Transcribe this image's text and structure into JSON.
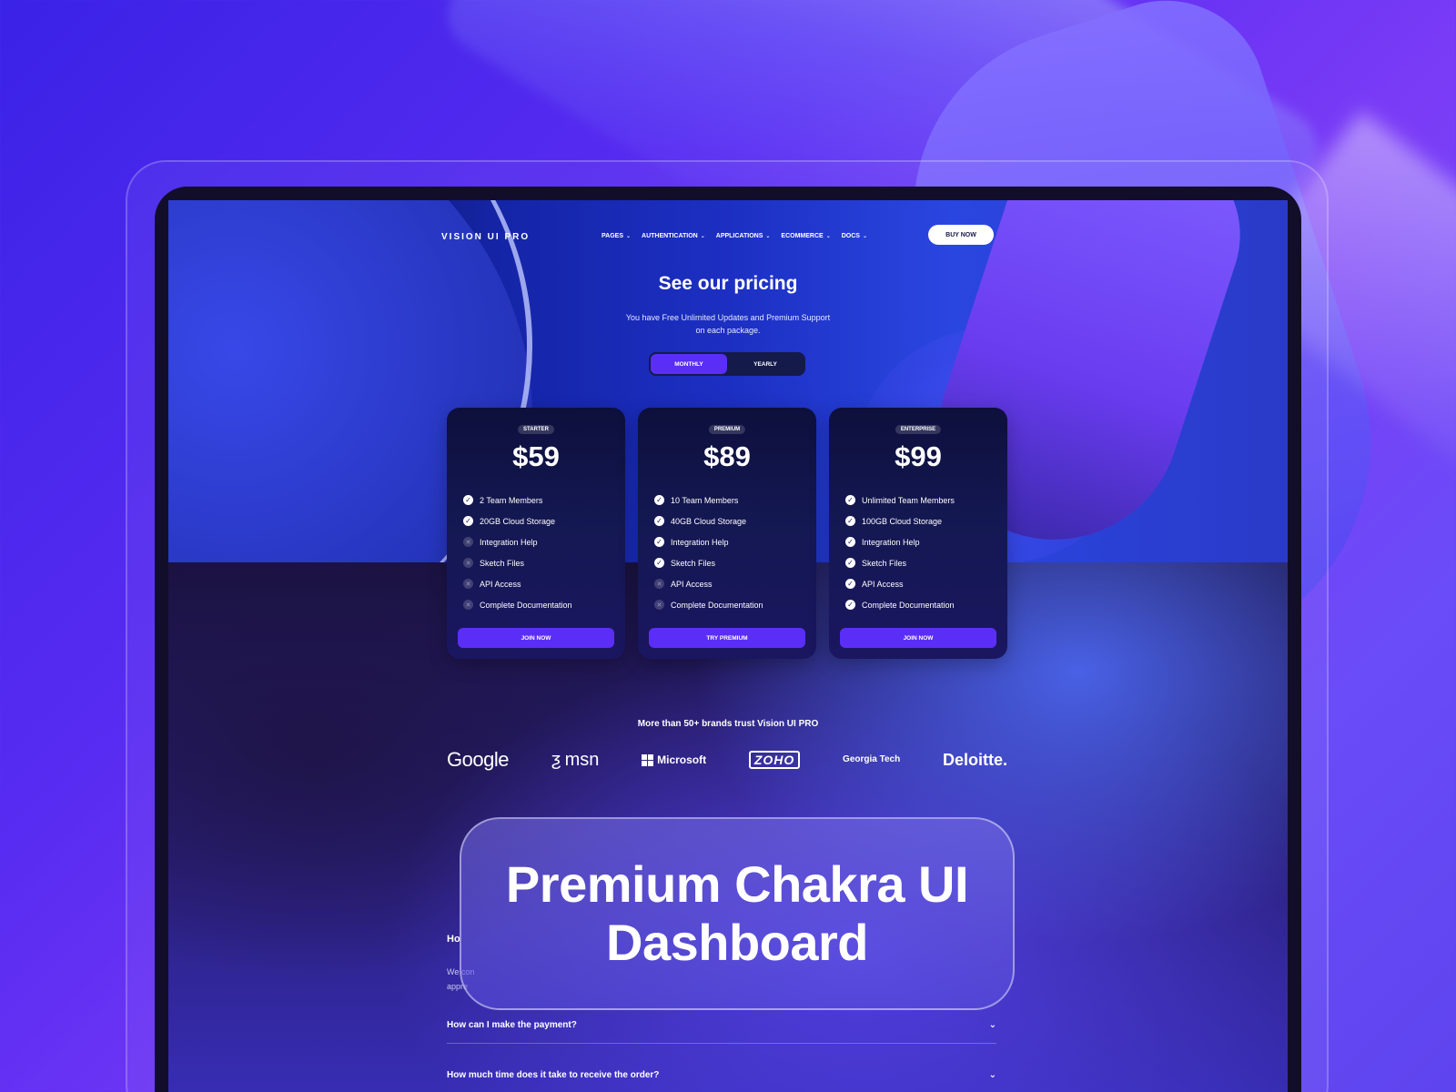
{
  "nav": {
    "logo": "VISION UI PRO",
    "links": [
      "PAGES",
      "AUTHENTICATION",
      "APPLICATIONS",
      "ECOMMERCE",
      "DOCS"
    ],
    "buy_now": "BUY NOW"
  },
  "hero": {
    "title": "See our pricing",
    "subtitle": "You have Free Unlimited Updates and Premium Support on each package."
  },
  "toggle": {
    "monthly": "MONTHLY",
    "yearly": "YEARLY",
    "selected": "MONTHLY"
  },
  "plans": [
    {
      "badge": "STARTER",
      "price": "$59",
      "button": "JOIN NOW",
      "features": [
        {
          "label": "2 Team Members",
          "included": true
        },
        {
          "label": "20GB Cloud Storage",
          "included": true
        },
        {
          "label": "Integration Help",
          "included": false
        },
        {
          "label": "Sketch Files",
          "included": false
        },
        {
          "label": "API Access",
          "included": false
        },
        {
          "label": "Complete Documentation",
          "included": false
        }
      ]
    },
    {
      "badge": "PREMIUM",
      "price": "$89",
      "button": "TRY PREMIUM",
      "features": [
        {
          "label": "10 Team Members",
          "included": true
        },
        {
          "label": "40GB Cloud Storage",
          "included": true
        },
        {
          "label": "Integration Help",
          "included": true
        },
        {
          "label": "Sketch Files",
          "included": true
        },
        {
          "label": "API Access",
          "included": false
        },
        {
          "label": "Complete Documentation",
          "included": false
        }
      ]
    },
    {
      "badge": "ENTERPRISE",
      "price": "$99",
      "button": "JOIN NOW",
      "features": [
        {
          "label": "Unlimited Team Members",
          "included": true
        },
        {
          "label": "100GB Cloud Storage",
          "included": true
        },
        {
          "label": "Integration Help",
          "included": true
        },
        {
          "label": "Sketch Files",
          "included": true
        },
        {
          "label": "API Access",
          "included": true
        },
        {
          "label": "Complete Documentation",
          "included": true
        }
      ]
    }
  ],
  "brands": {
    "title": "More than 50+ brands trust Vision UI PRO",
    "items": [
      "Google",
      "msn",
      "Microsoft",
      "ZOHO",
      "Georgia Tech",
      "Deloitte."
    ]
  },
  "faq": {
    "partial_heading": "Ho",
    "partial_text": "We con appre",
    "items": [
      "How can I make the payment?",
      "How much time does it take to receive the order?"
    ]
  },
  "overlay": {
    "title": "Premium Chakra UI Dashboard"
  },
  "colors": {
    "accent": "#5b2ef7",
    "card": "#141852",
    "background": "#5a2cf2"
  }
}
